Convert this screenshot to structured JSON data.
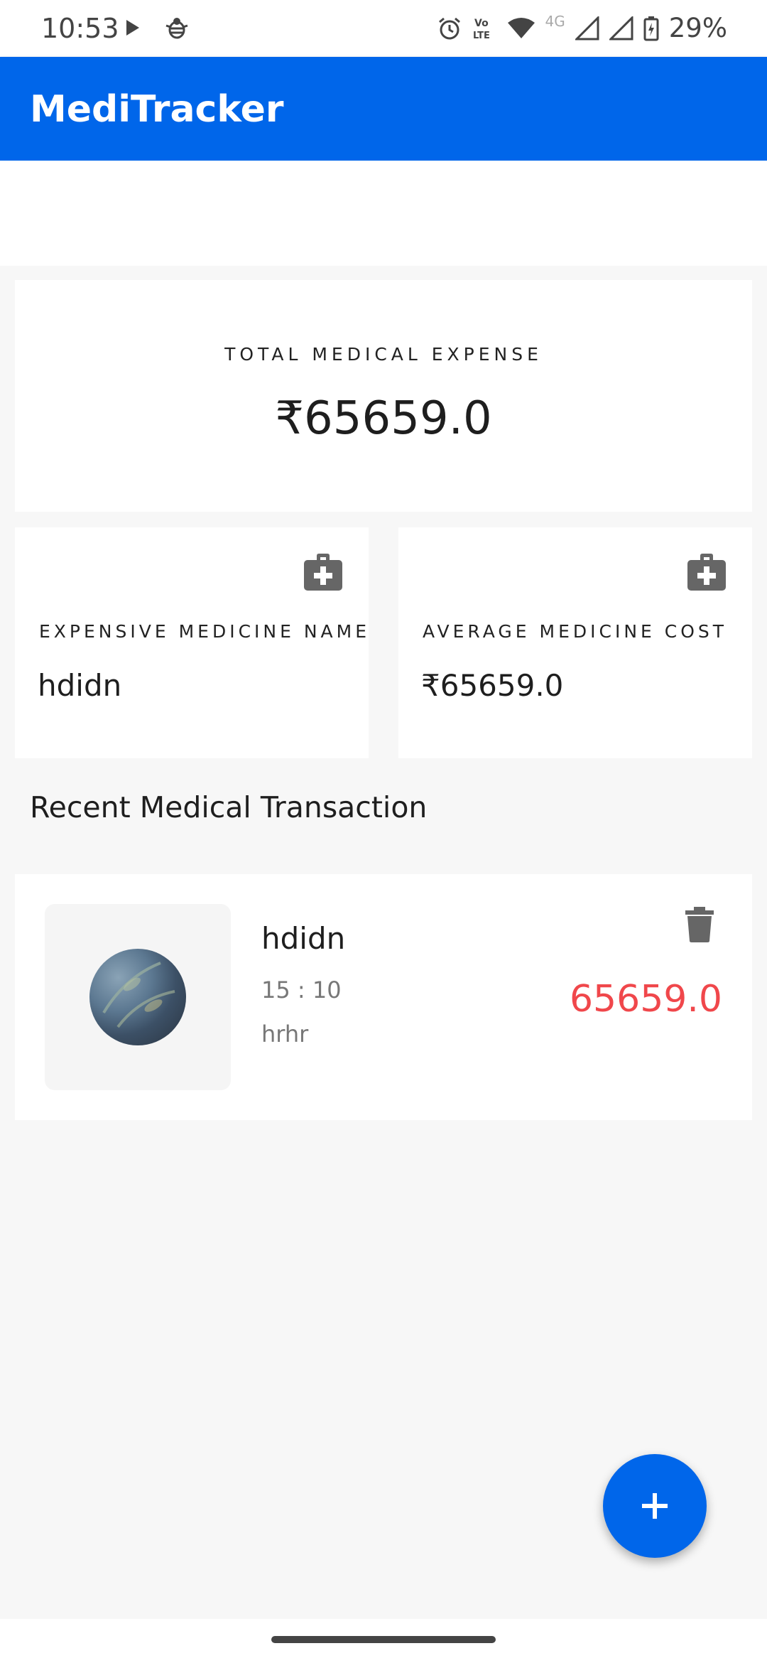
{
  "status_bar": {
    "time": "10:53",
    "battery": "29%",
    "network_type": "4G",
    "volte_top": "Vo",
    "volte_bottom": "LTE",
    "icons": [
      "play-icon",
      "bug-icon",
      "alarm-icon",
      "volte-icon",
      "wifi-icon",
      "signal-icon",
      "signal-icon",
      "battery-charging-icon"
    ]
  },
  "app_bar": {
    "title": "MediTracker"
  },
  "summary": {
    "total_label": "TOTAL MEDICAL EXPENSE",
    "total_value": "₹65659.0",
    "expensive_label": "EXPENSIVE MEDICINE NAME",
    "expensive_value": "hdidn",
    "average_label": "AVERAGE MEDICINE COST",
    "average_value": "₹65659.0",
    "card_icon": "medical-kit-icon"
  },
  "recent": {
    "section_title": "Recent Medical Transaction",
    "transactions": [
      {
        "name": "hdidn",
        "time": "15 : 10",
        "note": "hrhr",
        "amount": "65659.0"
      }
    ]
  },
  "colors": {
    "primary": "#0066ea",
    "amount_red": "#f0474b",
    "background": "#f7f7f7"
  },
  "fab": {
    "icon": "plus-icon"
  }
}
